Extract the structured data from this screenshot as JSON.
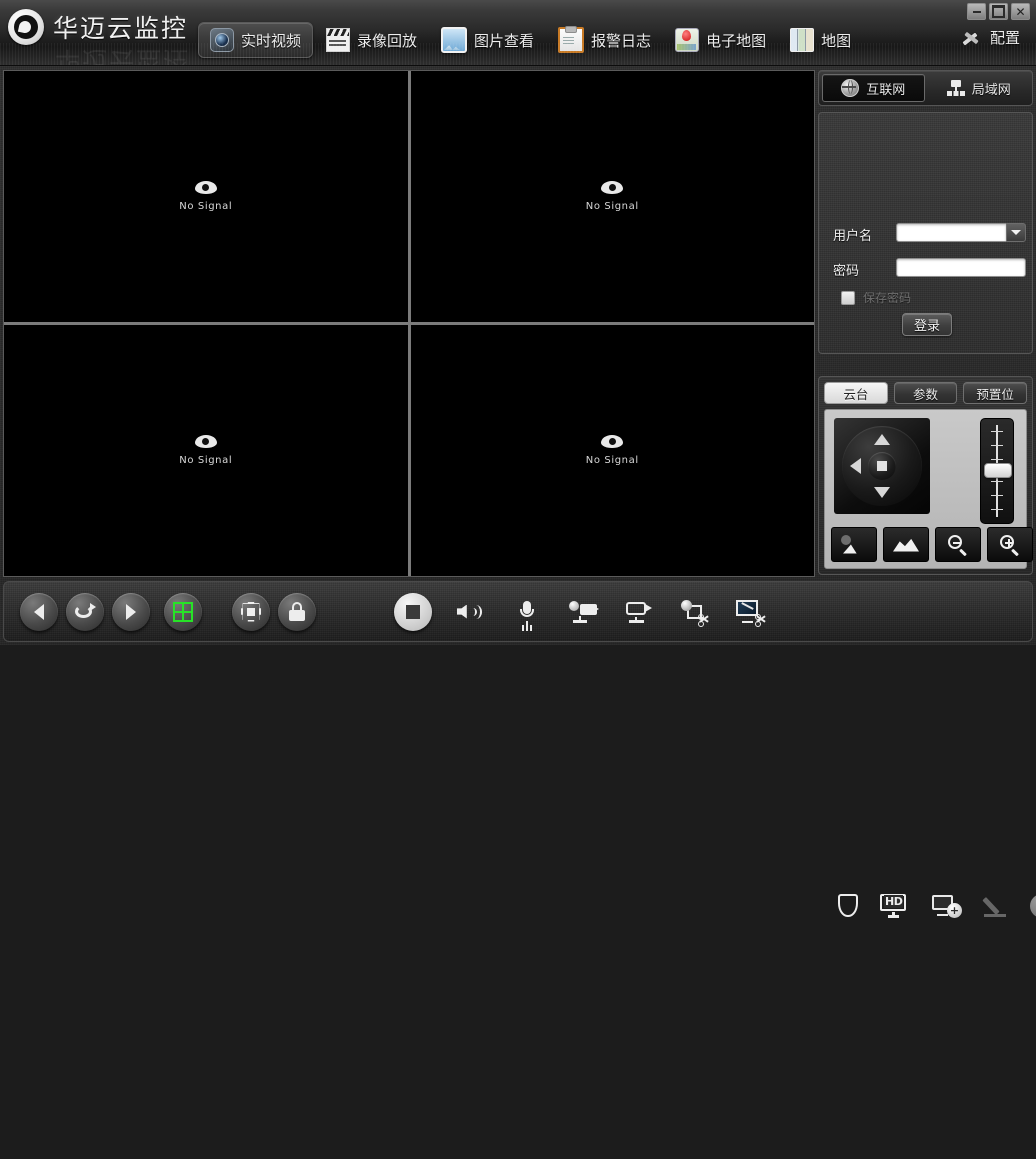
{
  "window": {
    "title": "华迈云监控",
    "controls": {
      "minimize": "–",
      "maximize": "□",
      "close": "✕"
    }
  },
  "nav": {
    "items": [
      {
        "label": "实时视频",
        "icon": "camera-lens-icon",
        "active": true
      },
      {
        "label": "录像回放",
        "icon": "clapperboard-icon",
        "active": false
      },
      {
        "label": "图片查看",
        "icon": "picture-icon",
        "active": false
      },
      {
        "label": "报警日志",
        "icon": "clipboard-icon",
        "active": false
      },
      {
        "label": "电子地图",
        "icon": "map-pin-icon",
        "active": false
      },
      {
        "label": "地图",
        "icon": "folded-map-icon",
        "active": false
      }
    ],
    "config": {
      "label": "配置",
      "icon": "tools-icon"
    }
  },
  "video": {
    "panes": [
      {
        "status": "No Signal",
        "icon": "eye-icon"
      },
      {
        "status": "No Signal",
        "icon": "eye-icon"
      },
      {
        "status": "No Signal",
        "icon": "eye-icon"
      },
      {
        "status": "No Signal",
        "icon": "eye-icon"
      }
    ]
  },
  "connection": {
    "tabs": [
      {
        "label": "互联网",
        "icon": "globe-icon",
        "active": true
      },
      {
        "label": "局域网",
        "icon": "lan-icon",
        "active": false
      }
    ]
  },
  "login": {
    "username_label": "用户名",
    "username_value": "",
    "username_placeholder": "",
    "password_label": "密码",
    "password_value": "",
    "password_placeholder": "",
    "remember_label": "保存密码",
    "submit_label": "登录"
  },
  "ptz": {
    "tabs": [
      {
        "label": "云台",
        "active": true
      },
      {
        "label": "参数",
        "active": false
      },
      {
        "label": "预置位",
        "active": false
      }
    ],
    "dpad": {
      "up": "up-arrow-icon",
      "down": "down-arrow-icon",
      "left": "left-arrow-icon",
      "right": "right-arrow-icon",
      "center": "stop-square-icon"
    },
    "buttons": [
      {
        "icon": "iris-close-icon"
      },
      {
        "icon": "iris-open-icon"
      },
      {
        "icon": "zoom-out-icon"
      },
      {
        "icon": "zoom-in-icon"
      }
    ]
  },
  "bottombar": {
    "left_group": [
      {
        "icon": "previous-icon"
      },
      {
        "icon": "loop-refresh-icon"
      },
      {
        "icon": "next-icon"
      },
      {
        "icon": "split-grid-icon"
      },
      {
        "icon": "fullscreen-icon"
      },
      {
        "icon": "lock-icon"
      }
    ],
    "tools": [
      {
        "icon": "stop-all-icon"
      },
      {
        "icon": "speaker-icon"
      },
      {
        "icon": "microphone-icon"
      },
      {
        "icon": "record-camera-icon"
      },
      {
        "icon": "local-record-icon"
      },
      {
        "icon": "snapshot-camera-icon"
      },
      {
        "icon": "snapshot-screen-icon"
      },
      {
        "icon": "shield-icon"
      },
      {
        "icon": "hd-stream-icon"
      },
      {
        "icon": "digital-zoom-icon"
      },
      {
        "icon": "pen-icon"
      },
      {
        "icon": "close-all-icon"
      },
      {
        "icon": "broadcast-mic-icon"
      },
      {
        "icon": "alarm-warning-icon"
      }
    ]
  },
  "colors": {
    "accent_green": "#27e327",
    "panel_bg": "#2e2e2e",
    "titlebar_bg": "#202020",
    "video_bg": "#000000"
  }
}
